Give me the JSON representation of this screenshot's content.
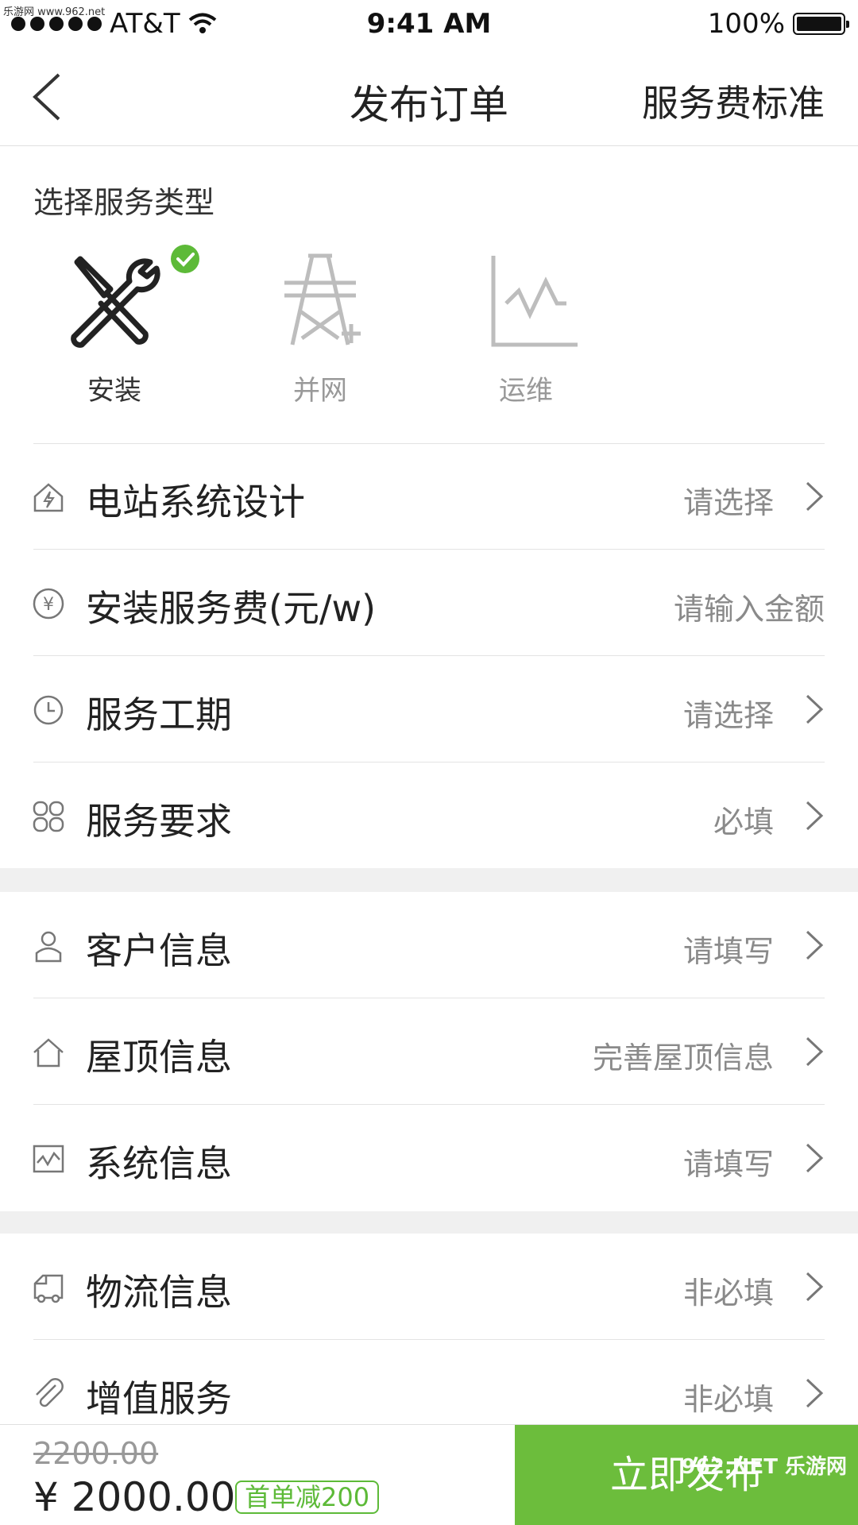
{
  "watermark_top": "乐游网 www.962.net",
  "status_bar": {
    "carrier": "AT&T",
    "time": "9:41 AM",
    "battery": "100%"
  },
  "nav": {
    "title": "发布订单",
    "right_action": "服务费标准"
  },
  "service_type": {
    "label": "选择服务类型",
    "options": [
      {
        "label": "安装",
        "icon": "tools-icon",
        "selected": true
      },
      {
        "label": "并网",
        "icon": "power-tower-icon",
        "selected": false
      },
      {
        "label": "运维",
        "icon": "chart-line-icon",
        "selected": false
      }
    ]
  },
  "rows": [
    {
      "icon": "house-bolt-icon",
      "title": "电站系统设计",
      "value": "请选择"
    },
    {
      "icon": "yuan-icon",
      "title": "安装服务费(元/w)",
      "value": "请输入金额"
    },
    {
      "icon": "clock-icon",
      "title": "服务工期",
      "value": "请选择"
    },
    {
      "icon": "grid-icon",
      "title": "服务要求",
      "value": "必填"
    },
    {
      "icon": "user-icon",
      "title": "客户信息",
      "value": "请填写"
    },
    {
      "icon": "home-icon",
      "title": "屋顶信息",
      "value": "完善屋顶信息"
    },
    {
      "icon": "system-chart-icon",
      "title": "系统信息",
      "value": "请填写"
    },
    {
      "icon": "truck-icon",
      "title": "物流信息",
      "value": "非必填"
    },
    {
      "icon": "paperclip-icon",
      "title": "增值服务",
      "value": "非必填"
    }
  ],
  "bottom": {
    "old_price": "2200.00",
    "price": "¥ 2000.00",
    "badge": "首单减200",
    "publish_label": "立即发布",
    "watermark": "962.NET 乐游网"
  },
  "colors": {
    "accent": "#6cbd3c",
    "check": "#5dba38",
    "muted": "#8a8a8a"
  }
}
